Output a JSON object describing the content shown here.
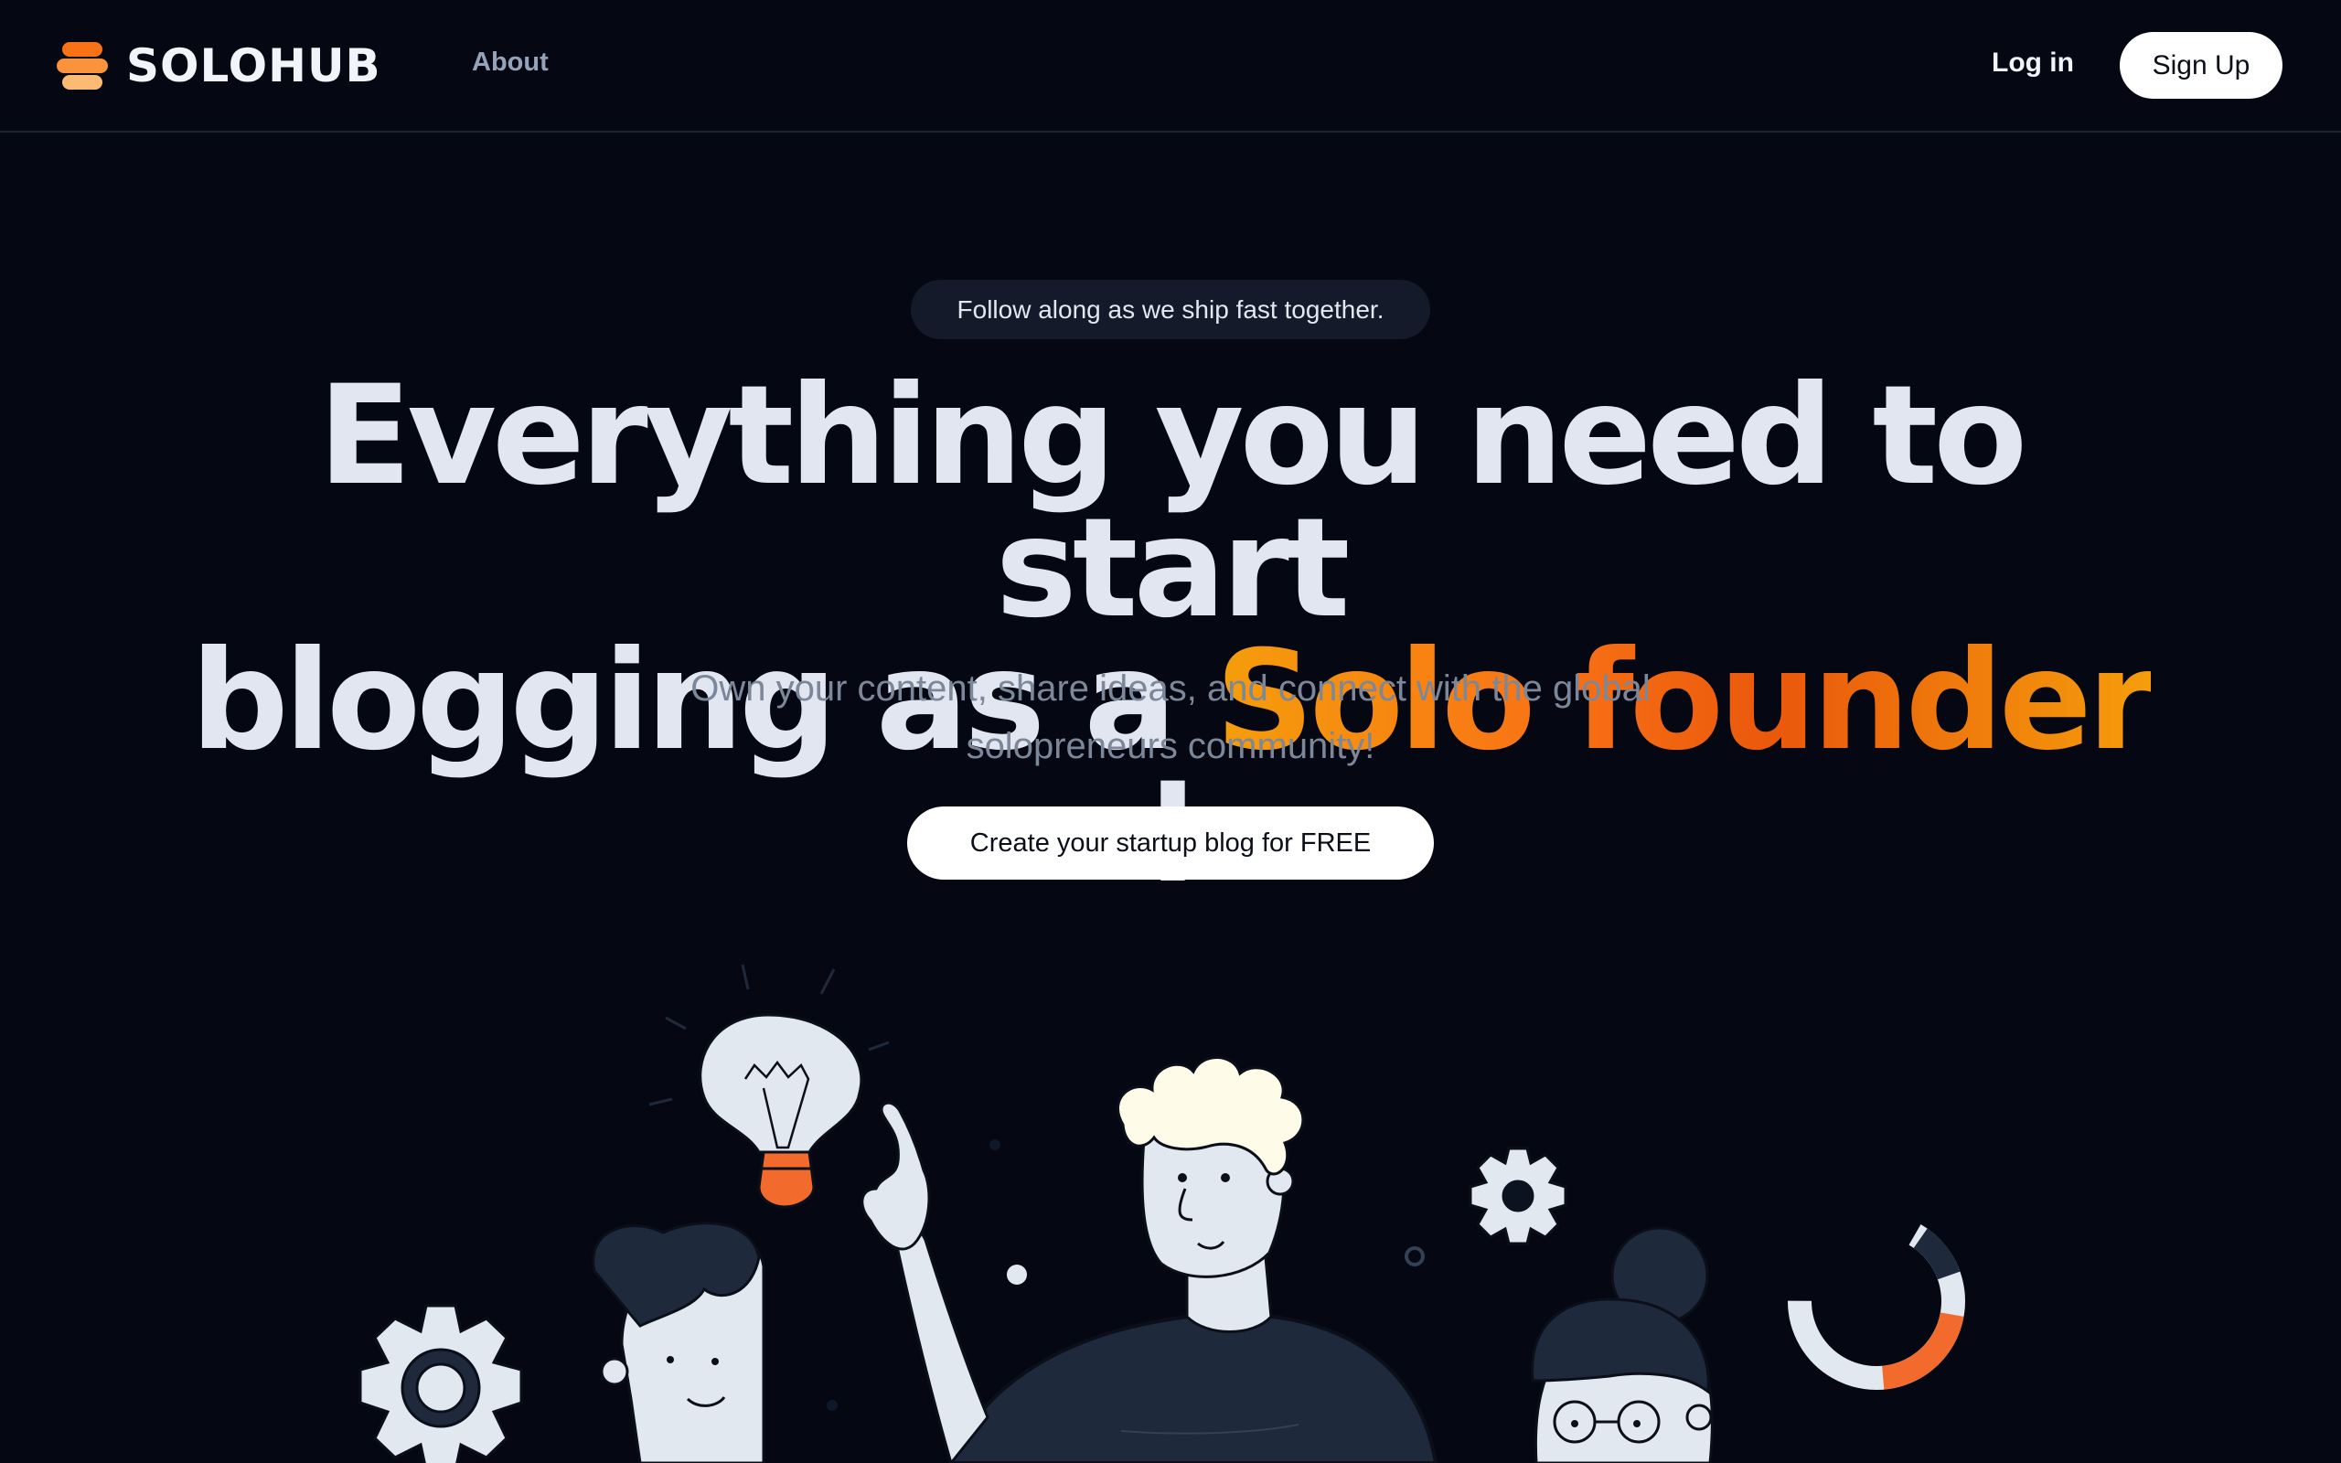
{
  "brand": {
    "name": "SOLOHUB",
    "logo_colors": [
      "#f97316",
      "#fb923c",
      "#fdba74"
    ]
  },
  "nav": {
    "about": "About",
    "login": "Log in",
    "signup": "Sign Up"
  },
  "hero": {
    "pill": "Follow along as we ship fast together.",
    "headline_line1": "Everything you need to start",
    "headline_line2_prefix": "blogging as a",
    "headline_accent": "Solo founder",
    "headline_suffix": "!",
    "subtext": "Own your content, share ideas, and connect with the global solopreneurs community!",
    "cta": "Create your startup blog for FREE"
  },
  "colors": {
    "background": "#050812",
    "accent_orange": "#f97316",
    "accent_amber": "#f59e0b",
    "text_muted": "#7c879a"
  },
  "illustration": {
    "elements": [
      "lightbulb-icon",
      "gear-icon",
      "person-pointing",
      "person-left",
      "person-right",
      "progress-ring"
    ]
  }
}
